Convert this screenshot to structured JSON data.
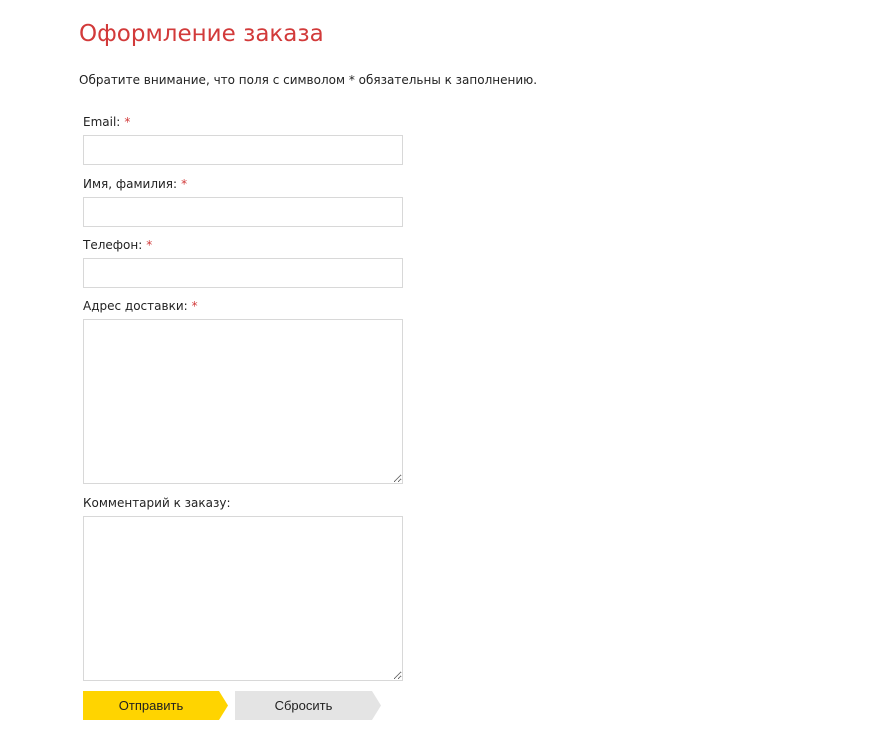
{
  "page": {
    "title": "Оформление заказа",
    "notice": "Обратите внимание, что поля с символом * обязательны к заполнению."
  },
  "form": {
    "required_mark": "*",
    "fields": [
      {
        "label": "Email:",
        "value": "",
        "required": true
      },
      {
        "label": "Имя, фамилия:",
        "value": "",
        "required": true
      },
      {
        "label": "Телефон:",
        "value": "",
        "required": true
      },
      {
        "label": "Адрес доставки:",
        "value": "",
        "required": true
      },
      {
        "label": "Комментарий к заказу:",
        "value": "",
        "required": false
      }
    ],
    "submit_label": "Отправить",
    "reset_label": "Сбросить"
  },
  "colors": {
    "title": "#d23a3a",
    "required_mark": "#d23a3a",
    "submit_button": "#ffd400",
    "reset_button": "#e4e4e4",
    "input_border": "#d8d8d8"
  }
}
